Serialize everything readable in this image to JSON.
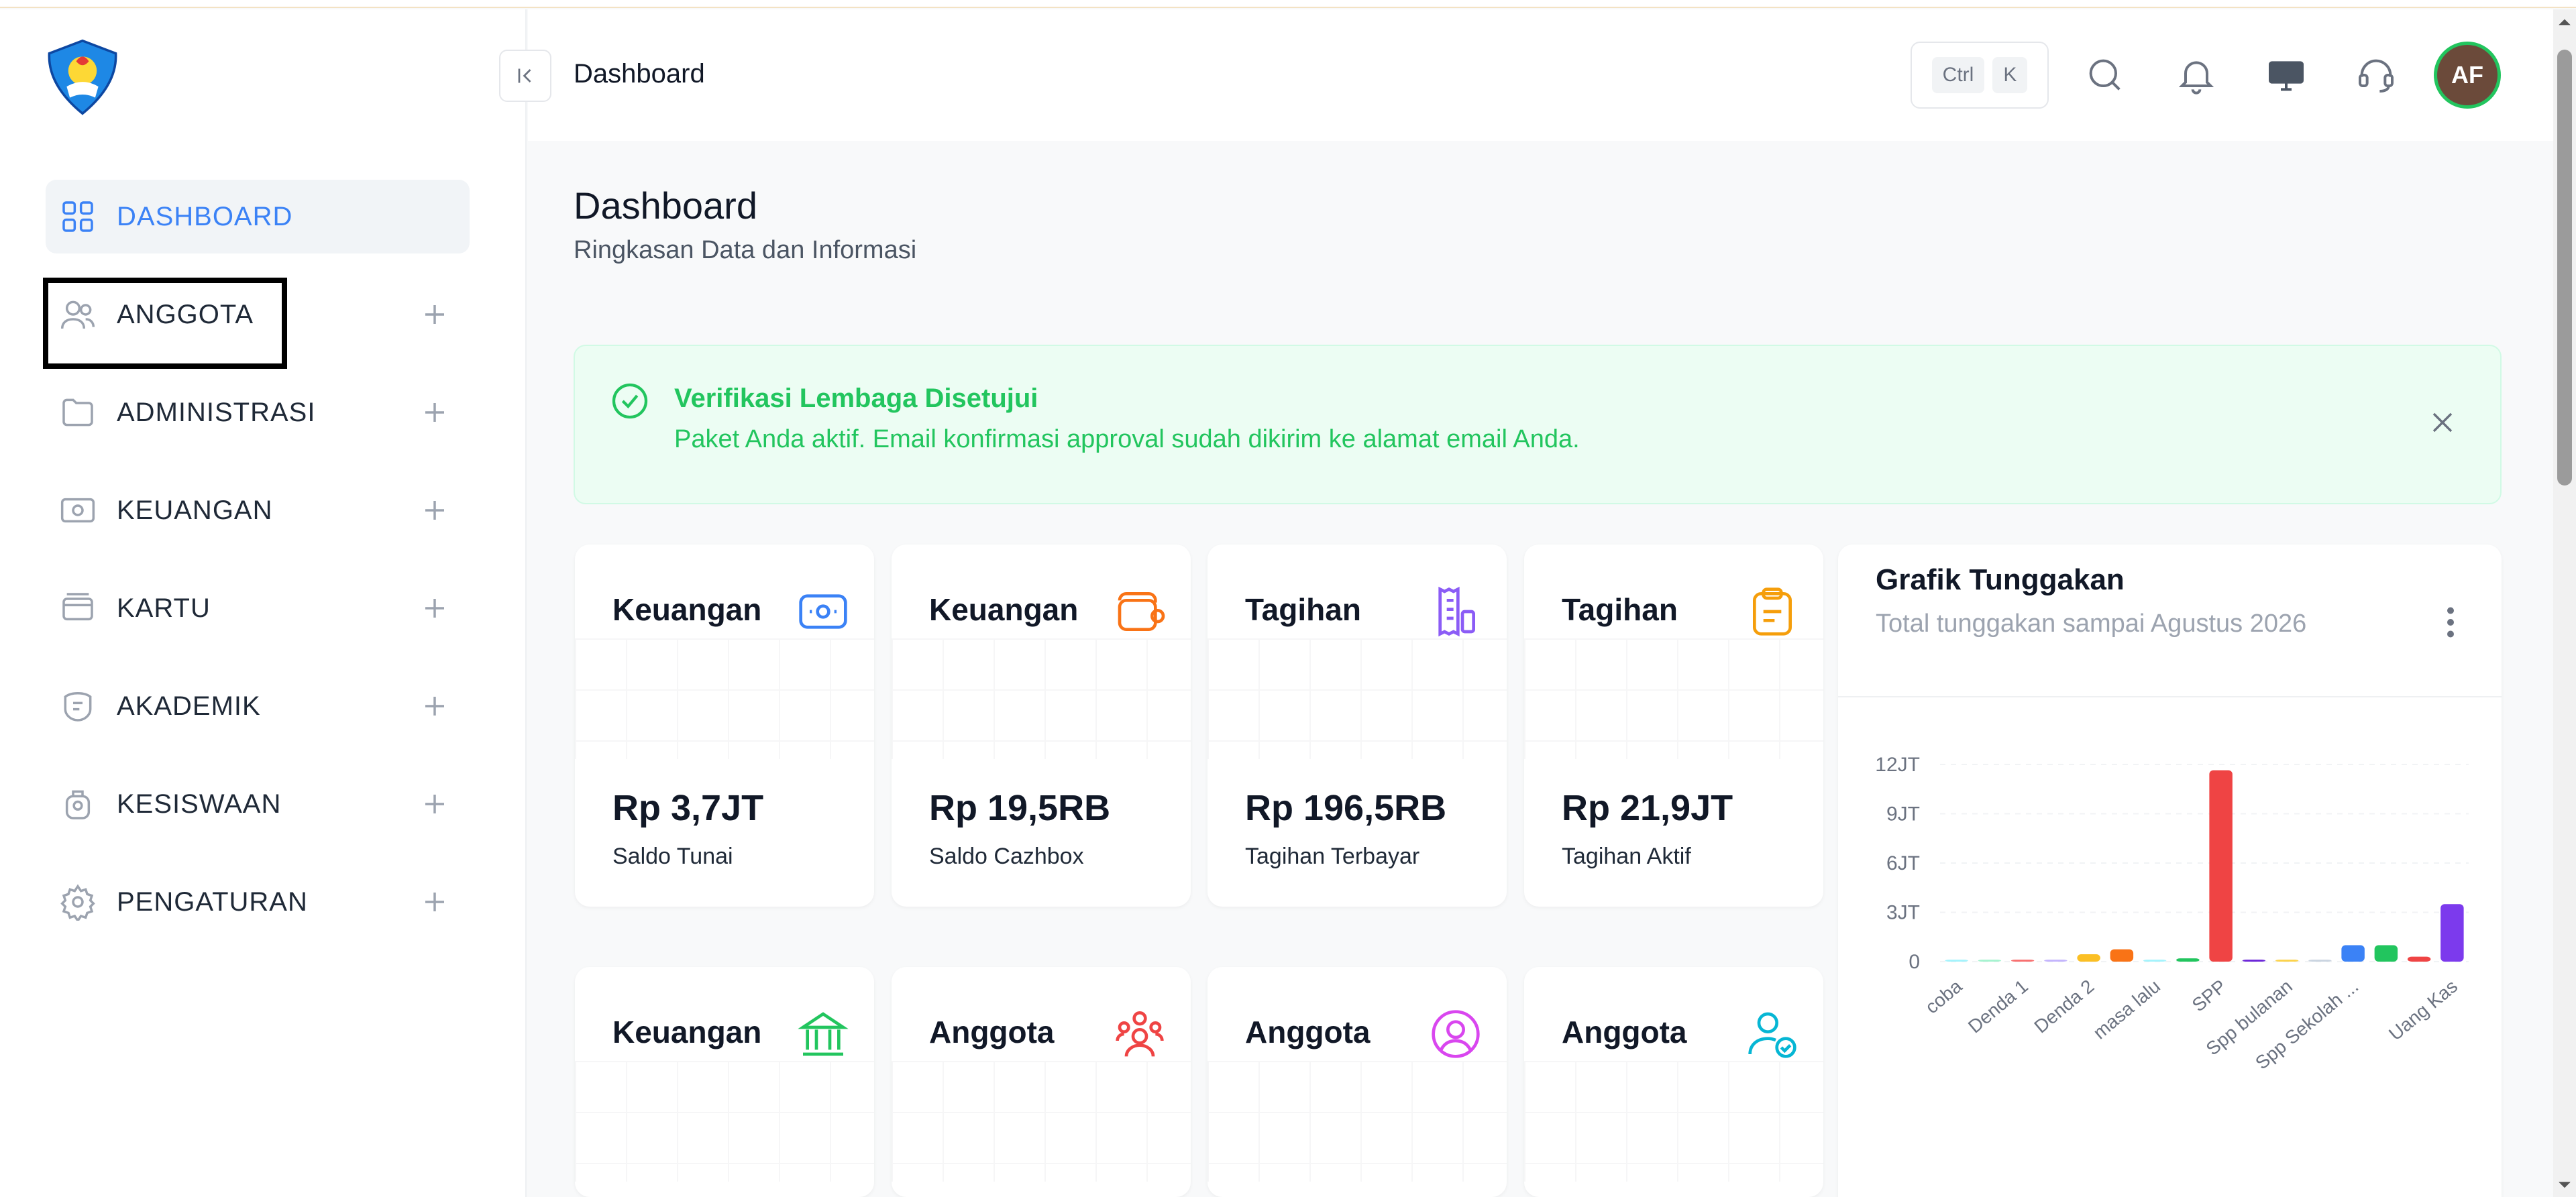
{
  "header": {
    "title": "Dashboard",
    "kbd_ctrl": "Ctrl",
    "kbd_k": "K",
    "avatar_initials": "AF"
  },
  "sidebar": {
    "items": [
      {
        "label": "DASHBOARD",
        "icon": "grid-icon",
        "active": true
      },
      {
        "label": "ANGGOTA",
        "icon": "users-icon"
      },
      {
        "label": "ADMINISTRASI",
        "icon": "folder-icon"
      },
      {
        "label": "KEUANGAN",
        "icon": "cash-icon"
      },
      {
        "label": "KARTU",
        "icon": "card-icon"
      },
      {
        "label": "AKADEMIK",
        "icon": "academic-icon"
      },
      {
        "label": "KESISWAAN",
        "icon": "student-icon"
      },
      {
        "label": "PENGATURAN",
        "icon": "gear-icon"
      }
    ]
  },
  "page": {
    "title": "Dashboard",
    "subtitle": "Ringkasan Data dan Informasi"
  },
  "alert": {
    "title": "Verifikasi Lembaga Disetujui",
    "message": "Paket Anda aktif. Email konfirmasi approval sudah dikirim ke alamat email Anda."
  },
  "cards": [
    {
      "title": "Keuangan",
      "value": "Rp 3,7JT",
      "label": "Saldo Tunai",
      "icon": "cash-icon",
      "color": "#3b82f6"
    },
    {
      "title": "Keuangan",
      "value": "Rp 19,5RB",
      "label": "Saldo Cazhbox",
      "icon": "wallet-icon",
      "color": "#f97316"
    },
    {
      "title": "Tagihan",
      "value": "Rp 196,5RB",
      "label": "Tagihan Terbayar",
      "icon": "receipt-icon",
      "color": "#8b5cf6"
    },
    {
      "title": "Tagihan",
      "value": "Rp 21,9JT",
      "label": "Tagihan Aktif",
      "icon": "clipboard-icon",
      "color": "#f59e0b"
    },
    {
      "title": "Keuangan",
      "icon": "bank-icon",
      "color": "#22c55e"
    },
    {
      "title": "Anggota",
      "icon": "group-icon",
      "color": "#ef4444"
    },
    {
      "title": "Anggota",
      "icon": "user-circle-icon",
      "color": "#d946ef"
    },
    {
      "title": "Anggota",
      "icon": "user-check-icon",
      "color": "#06b6d4"
    }
  ],
  "chart": {
    "title": "Grafik Tunggakan",
    "subtitle": "Total tunggakan sampai Agustus 2026"
  },
  "chart_data": {
    "type": "bar",
    "title": "Grafik Tunggakan",
    "categories": [
      "coba",
      "",
      "Denda 1",
      "",
      "Denda 2",
      "",
      "masa lalu",
      "",
      "SPP",
      "",
      "Spp bulanan",
      "",
      "Spp Sekolah ...",
      "",
      "",
      "Uang Kas"
    ],
    "values": [
      20000,
      20000,
      60000,
      50000,
      450000,
      750000,
      20000,
      200000,
      11650000,
      100000,
      40000,
      20000,
      1000000,
      1000000,
      300000,
      3500000
    ],
    "colors": [
      "#a5f3fc",
      "#a7f3d0",
      "#f87171",
      "#c4b5fd",
      "#fbbf24",
      "#f97316",
      "#a5f3fc",
      "#22c55e",
      "#ef4444",
      "#6d28d9",
      "#fcd34d",
      "#cbd5e1",
      "#3b82f6",
      "#22c55e",
      "#ef4444",
      "#7c3aed"
    ],
    "yticks": [
      "0",
      "3JT",
      "6JT",
      "9JT",
      "12JT"
    ],
    "ytick_values": [
      0,
      3000000,
      6000000,
      9000000,
      12000000
    ],
    "ylim": [
      0,
      12000000
    ],
    "grid": true
  }
}
